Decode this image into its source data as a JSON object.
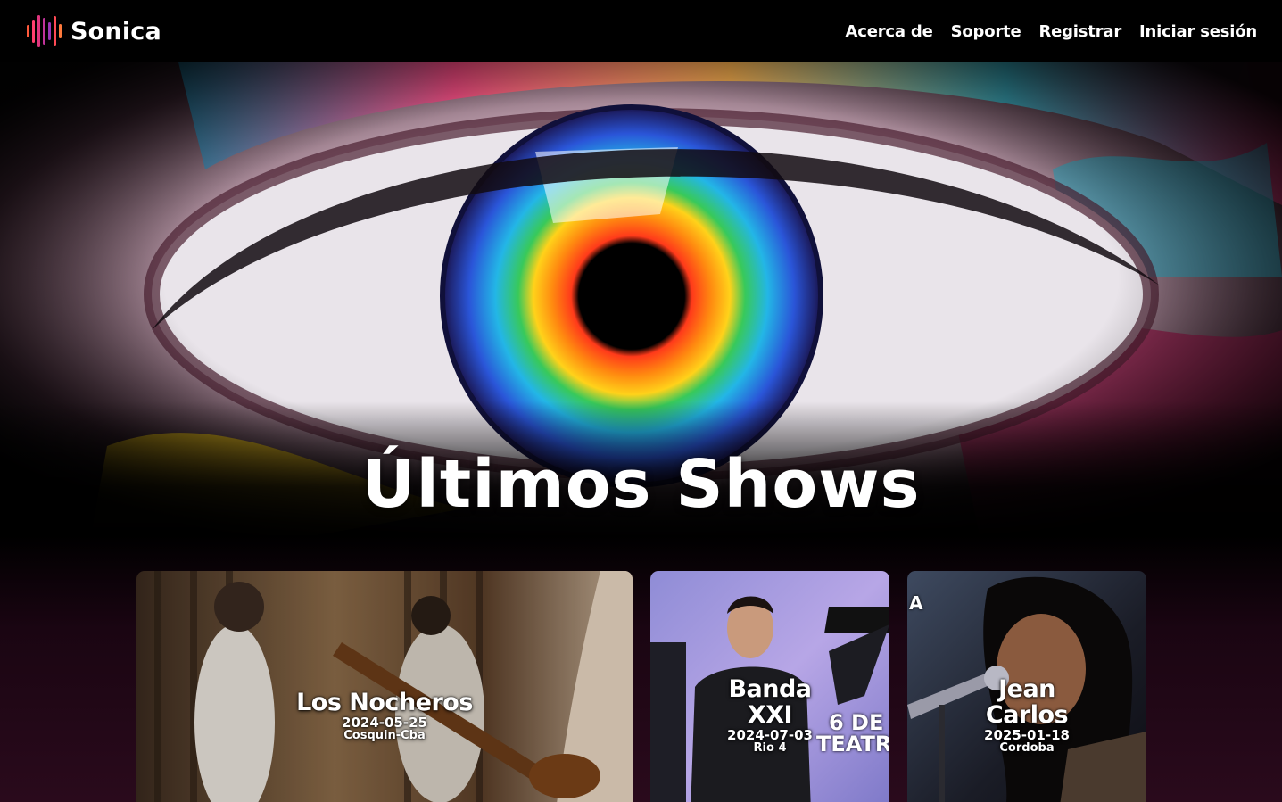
{
  "brand": {
    "name": "Sonica",
    "logo_colors": [
      "#ff5a3c",
      "#ff3f6e",
      "#e0357d",
      "#c0339a",
      "#9a34b5",
      "#ff4a55",
      "#ff7a3c"
    ]
  },
  "nav": {
    "items": [
      {
        "label": "Acerca de"
      },
      {
        "label": "Soporte"
      },
      {
        "label": "Registrar"
      },
      {
        "label": "Iniciar sesión"
      }
    ]
  },
  "hero": {
    "title": "Últimos Shows"
  },
  "shows": [
    {
      "name": "Los Nocheros",
      "date": "2024-05-25",
      "place": "Cosquin-Cba"
    },
    {
      "name": "Banda XXI",
      "date": "2024-07-03",
      "place": "Rio 4",
      "poster_text": "6 DE",
      "poster_text_2": "TEATR"
    },
    {
      "name": "Jean Carlos",
      "date": "2025-01-18",
      "place": "Cordoba",
      "poster_letter": "A"
    }
  ],
  "colors": {
    "background": "#000000",
    "section_gradient_end": "#2a0a1c",
    "text": "#ffffff"
  }
}
